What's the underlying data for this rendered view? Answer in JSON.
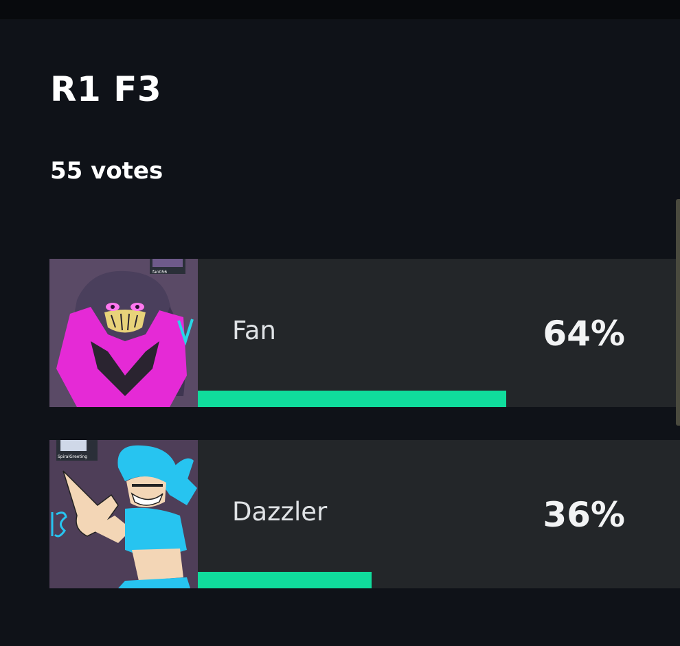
{
  "poll": {
    "title": "R1 F3",
    "votes": "55 votes",
    "options": [
      {
        "label": "Fan",
        "percent_text": "64%",
        "percent": 64,
        "thumbnail_credit": "fan056",
        "image": "fan-character-art"
      },
      {
        "label": "Dazzler",
        "percent_text": "36%",
        "percent": 36,
        "thumbnail_credit": "SpiralGreeting",
        "image": "dazzler-character-art"
      }
    ]
  },
  "colors": {
    "background": "#0f1218",
    "option_background": "#232629",
    "bar": "#10dc9c",
    "text": "#ffffff"
  }
}
